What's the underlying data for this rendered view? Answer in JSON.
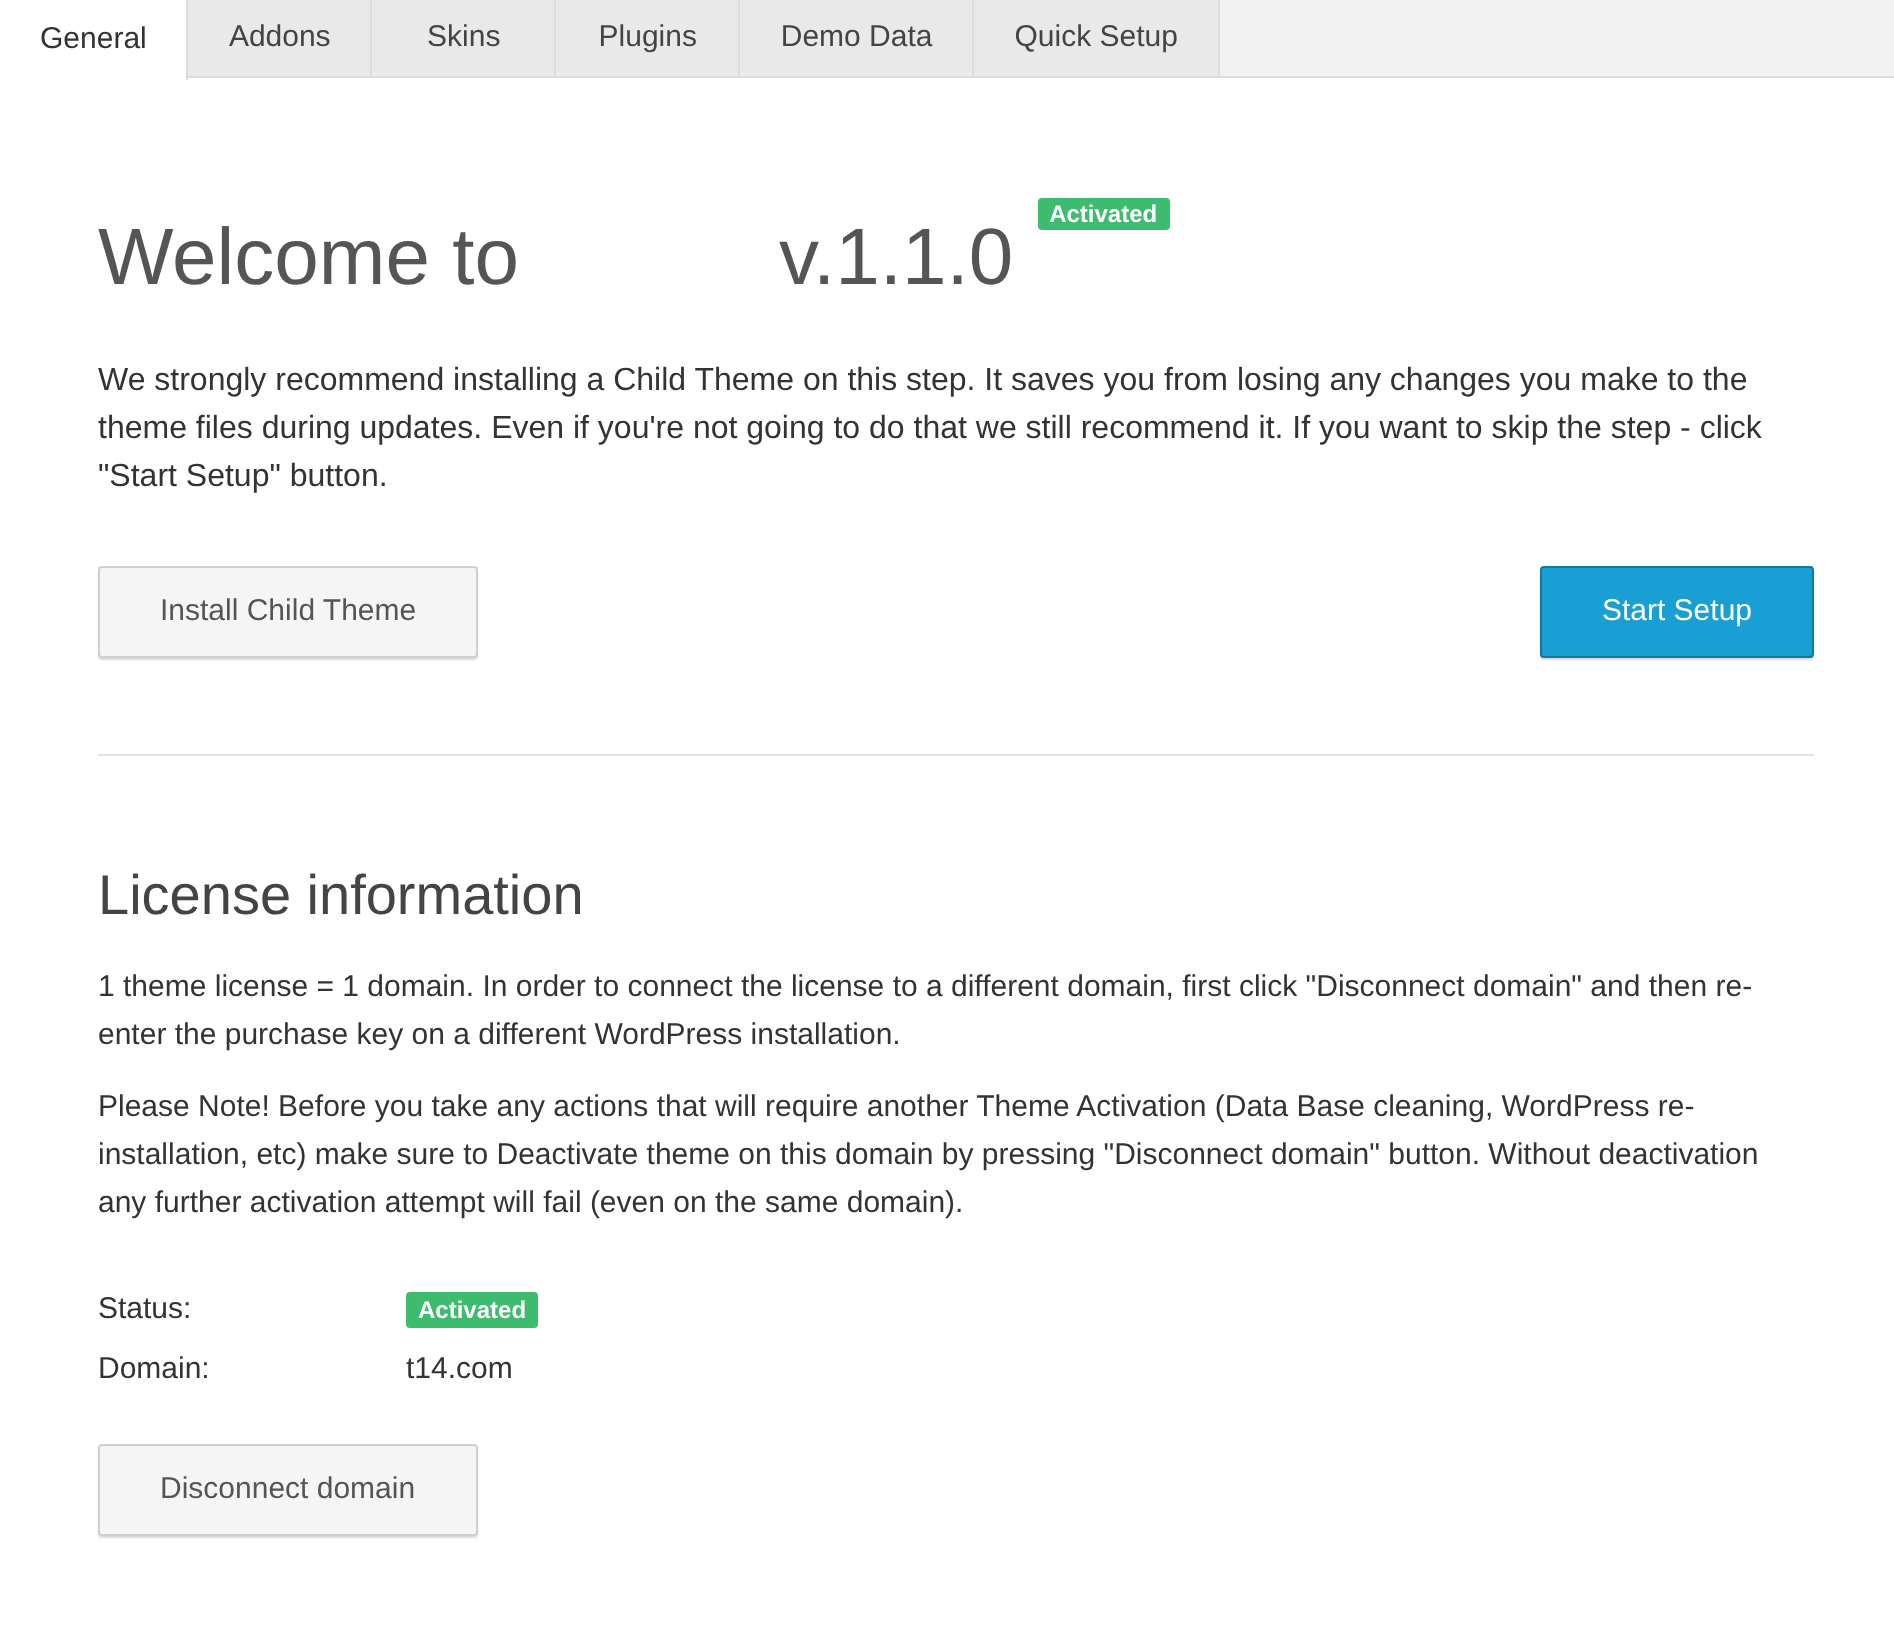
{
  "tabs": [
    {
      "label": "General",
      "selected": true
    },
    {
      "label": "Addons",
      "selected": false
    },
    {
      "label": "Skins",
      "selected": false
    },
    {
      "label": "Plugins",
      "selected": false
    },
    {
      "label": "Demo Data",
      "selected": false
    },
    {
      "label": "Quick Setup",
      "selected": false
    }
  ],
  "welcome": {
    "title": "Welcome to",
    "version": "v.1.1.0",
    "badge": "Activated",
    "text": "We strongly recommend installing a Child Theme on this step. It saves you from losing any changes you make to the theme files during updates. Even if you're not going to do that we still recommend it. If you want to skip the step - click \"Start Setup\" button.",
    "buttons": [
      {
        "label": "Install Child Theme",
        "kind": "secondary"
      },
      {
        "label": "Start Setup",
        "kind": "primary"
      }
    ]
  },
  "license": {
    "title": "License information",
    "paragraphs": [
      "1 theme license = 1 domain. In order to connect the license to a different domain, first click \"Disconnect domain\" and then re-enter the purchase key on a different WordPress installation.",
      "Please Note! Before you take any actions that will require another Theme Activation (Data Base cleaning, WordPress re-installation, etc) make sure to Deactivate theme on this domain by pressing \"Disconnect domain\" button. Without deactivation any further activation attempt will fail (even on the same domain)."
    ],
    "fields": [
      {
        "label": "Status:",
        "value": "Activated",
        "kind": "badge"
      },
      {
        "label": "Domain:",
        "value": "t14.com",
        "kind": "text"
      }
    ],
    "button": "Disconnect domain"
  }
}
